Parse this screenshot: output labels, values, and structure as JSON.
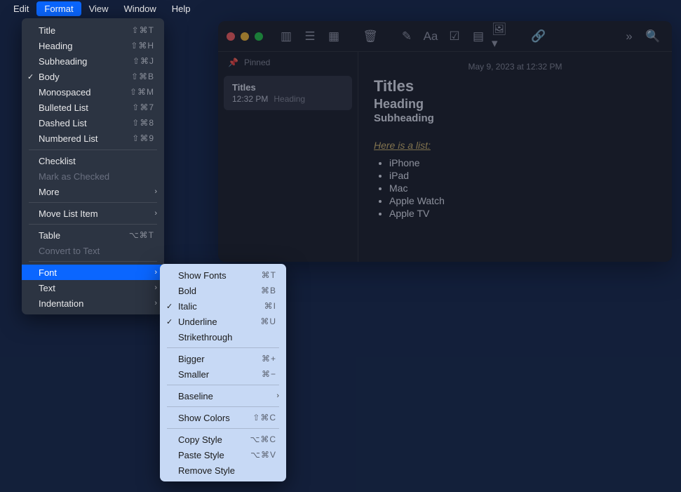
{
  "menubar": {
    "items": [
      "Edit",
      "Format",
      "View",
      "Window",
      "Help"
    ],
    "activeIndex": 1
  },
  "formatMenu": {
    "title": {
      "label": "Title",
      "shortcut": "⇧⌘T"
    },
    "heading": {
      "label": "Heading",
      "shortcut": "⇧⌘H"
    },
    "subheading": {
      "label": "Subheading",
      "shortcut": "⇧⌘J"
    },
    "body": {
      "label": "Body",
      "shortcut": "⇧⌘B",
      "checked": true
    },
    "monospaced": {
      "label": "Monospaced",
      "shortcut": "⇧⌘M"
    },
    "bulleted": {
      "label": "Bulleted List",
      "shortcut": "⇧⌘7"
    },
    "dashed": {
      "label": "Dashed List",
      "shortcut": "⇧⌘8"
    },
    "numbered": {
      "label": "Numbered List",
      "shortcut": "⇧⌘9"
    },
    "checklist": {
      "label": "Checklist"
    },
    "markChecked": {
      "label": "Mark as Checked",
      "disabled": true
    },
    "more": {
      "label": "More",
      "hasSubmenu": true
    },
    "moveList": {
      "label": "Move List Item",
      "hasSubmenu": true
    },
    "table": {
      "label": "Table",
      "shortcut": "⌥⌘T"
    },
    "convertText": {
      "label": "Convert to Text",
      "disabled": true
    },
    "font": {
      "label": "Font",
      "hasSubmenu": true,
      "highlighted": true
    },
    "text": {
      "label": "Text",
      "hasSubmenu": true
    },
    "indentation": {
      "label": "Indentation",
      "hasSubmenu": true
    }
  },
  "fontSubmenu": {
    "showFonts": {
      "label": "Show Fonts",
      "shortcut": "⌘T"
    },
    "bold": {
      "label": "Bold",
      "shortcut": "⌘B"
    },
    "italic": {
      "label": "Italic",
      "shortcut": "⌘I",
      "checked": true
    },
    "underline": {
      "label": "Underline",
      "shortcut": "⌘U",
      "checked": true
    },
    "strike": {
      "label": "Strikethrough"
    },
    "bigger": {
      "label": "Bigger",
      "shortcut": "⌘+"
    },
    "smaller": {
      "label": "Smaller",
      "shortcut": "⌘−"
    },
    "baseline": {
      "label": "Baseline",
      "hasSubmenu": true
    },
    "showColors": {
      "label": "Show Colors",
      "shortcut": "⇧⌘C"
    },
    "copyStyle": {
      "label": "Copy Style",
      "shortcut": "⌥⌘C"
    },
    "pasteStyle": {
      "label": "Paste Style",
      "shortcut": "⌥⌘V"
    },
    "removeStyle": {
      "label": "Remove Style"
    }
  },
  "notes": {
    "dateHeader": "May 9, 2023 at 12:32 PM",
    "pinnedLabel": "Pinned",
    "card": {
      "title": "Titles",
      "time": "12:32 PM",
      "preview": "Heading"
    },
    "content": {
      "h1": "Titles",
      "h2": "Heading",
      "h3": "Subheading",
      "listLabel": "Here is a list:",
      "items": [
        "iPhone",
        "iPad",
        "Mac",
        "Apple Watch",
        "Apple TV"
      ]
    }
  }
}
